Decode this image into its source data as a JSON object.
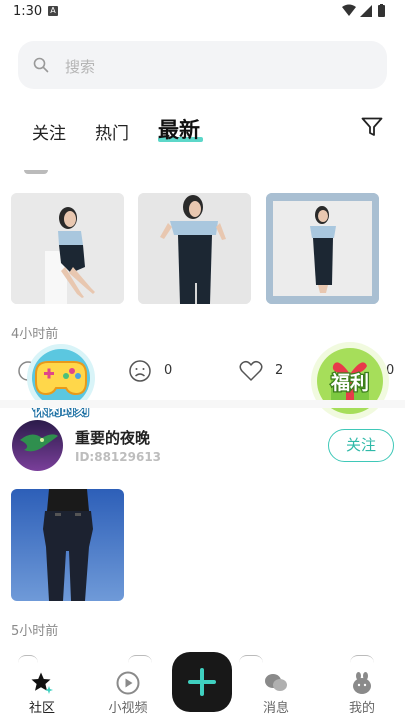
{
  "status_bar": {
    "time": "1:30",
    "notification_letter": "A"
  },
  "search": {
    "placeholder": "搜索"
  },
  "tabs": [
    {
      "label": "关注",
      "active": false
    },
    {
      "label": "热门",
      "active": false
    },
    {
      "label": "最新",
      "active": true
    }
  ],
  "accent_color": "#3fd0c0",
  "post1": {
    "time_ago": "4小时前",
    "comment_count": "0",
    "like_count": "2",
    "share_count": "0"
  },
  "badges": {
    "left": {
      "label": "休闲时刻",
      "icon": "gamepad-icon"
    },
    "right": {
      "label": "福利",
      "icon": "gift-icon"
    }
  },
  "post2": {
    "username": "重要的夜晚",
    "user_id": "ID:88129613",
    "follow_label": "关注",
    "time_ago": "5小时前"
  },
  "bottom_nav": {
    "community": "社区",
    "short_video": "小视频",
    "messages": "消息",
    "mine": "我的"
  }
}
